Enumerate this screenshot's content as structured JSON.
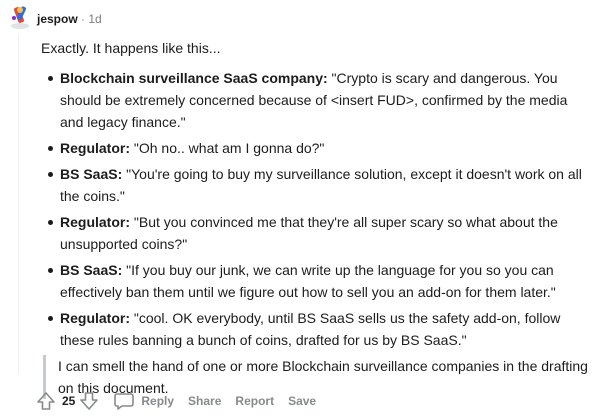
{
  "comment": {
    "author": "jespow",
    "separator": "·",
    "time": "1d",
    "intro": "Exactly. It happens like this...",
    "items": [
      {
        "speaker": "Blockchain surveillance SaaS company:",
        "text": " \"Crypto is scary and dangerous. You should be extremely concerned because of <insert FUD>, confirmed by the media and legacy finance.\""
      },
      {
        "speaker": "Regulator:",
        "text": " \"Oh no.. what am I gonna do?\""
      },
      {
        "speaker": "BS SaaS:",
        "text": " \"You're going to buy my surveillance solution, except it doesn't work on all the coins.\""
      },
      {
        "speaker": "Regulator:",
        "text": " \"But you convinced me that they're all super scary so what about the unsupported coins?\""
      },
      {
        "speaker": "BS SaaS:",
        "text": " \"If you buy our junk, we can write up the language for you so you can effectively ban them until we figure out how to sell you an add-on for them later.\""
      },
      {
        "speaker": "Regulator:",
        "text": " \"cool. OK everybody, until BS SaaS sells us the safety add-on, follow these rules banning a bunch of coins, drafted for us by BS SaaS.\""
      }
    ],
    "quote": "I can smell the hand of one or more Blockchain surveillance companies in the drafting on this document."
  },
  "actions": {
    "vote_count": "25",
    "reply": "Reply",
    "share": "Share",
    "report": "Report",
    "save": "Save"
  },
  "icons": {
    "avatar": "avatar-icon",
    "upvote": "upvote-arrow-icon",
    "downvote": "downvote-arrow-icon",
    "reply": "speech-bubble-icon"
  },
  "colors": {
    "text": "#1c1c1c",
    "muted": "#7c7c7c",
    "action": "#878a8c",
    "quote_bar": "#c8cbcd"
  }
}
